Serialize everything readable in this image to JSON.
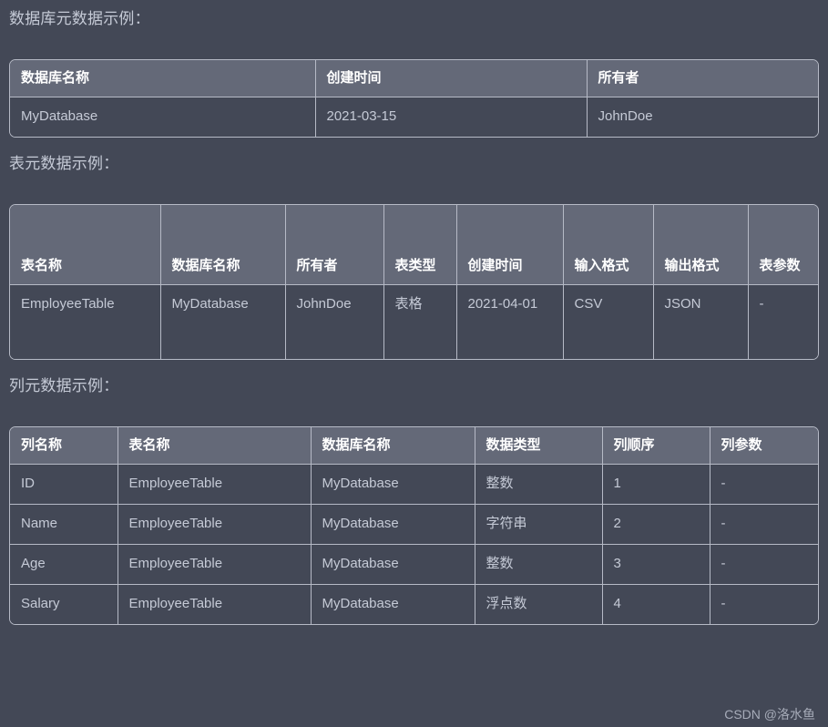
{
  "colors": {
    "page_background": "#434856",
    "header_background": "#646978",
    "cell_background": "#434856",
    "border": "#b6bac6",
    "heading_text": "#c5cad6",
    "header_text": "#ffffff",
    "body_text": "#c5cad6",
    "watermark_text": "#b0b5c2"
  },
  "sections": [
    {
      "title": "数据库元数据示例：",
      "table": {
        "name": "database-metadata-table",
        "columns": [
          "数据库名称",
          "创建时间",
          "所有者"
        ],
        "rows": [
          [
            "MyDatabase",
            "2021-03-15",
            "JohnDoe"
          ]
        ]
      }
    },
    {
      "title": "表元数据示例：",
      "table": {
        "name": "table-metadata-table",
        "columns": [
          "表名称",
          "数据库名称",
          "所有者",
          "表类型",
          "创建时间",
          "输入格式",
          "输出格式",
          "表参数"
        ],
        "rows": [
          [
            "EmployeeTable",
            "MyDatabase",
            "JohnDoe",
            "表格",
            "2021-04-01",
            "CSV",
            "JSON",
            "-"
          ]
        ]
      }
    },
    {
      "title": "列元数据示例：",
      "table": {
        "name": "column-metadata-table",
        "columns": [
          "列名称",
          "表名称",
          "数据库名称",
          "数据类型",
          "列顺序",
          "列参数"
        ],
        "rows": [
          [
            "ID",
            "EmployeeTable",
            "MyDatabase",
            "整数",
            "1",
            "-"
          ],
          [
            "Name",
            "EmployeeTable",
            "MyDatabase",
            "字符串",
            "2",
            "-"
          ],
          [
            "Age",
            "EmployeeTable",
            "MyDatabase",
            "整数",
            "3",
            "-"
          ],
          [
            "Salary",
            "EmployeeTable",
            "MyDatabase",
            "浮点数",
            "4",
            "-"
          ]
        ]
      }
    }
  ],
  "watermark": "CSDN @洛水鱼"
}
